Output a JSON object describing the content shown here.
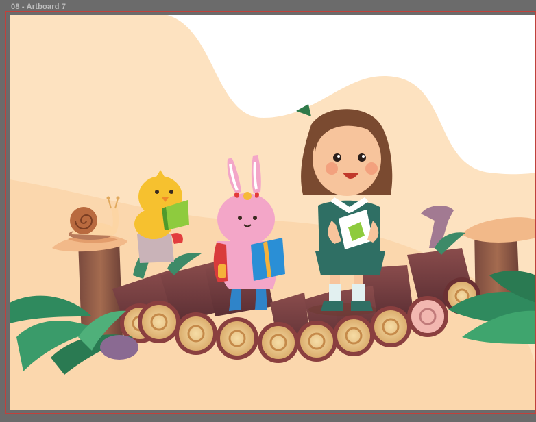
{
  "artboard": {
    "label": "08 - Artboard 7"
  },
  "illustration": {
    "characters": [
      "girl-character",
      "bunny-character",
      "chick-character",
      "snail-character"
    ],
    "colors": {
      "pasteboard": "#6b6b6b",
      "artboard_frame": "#c0413c",
      "sky": "#ffffff",
      "sand_light": "#fde2c0",
      "sand": "#fbd7ad",
      "log_dark": "#6e3a3a",
      "log_end": "#e9c98c",
      "leaf_green": "#2f8a5e",
      "girl_dress": "#2f6f64",
      "bunny_pink": "#f3a6c8",
      "chick_yellow": "#f6c12f",
      "book_blue": "#2a8fd6",
      "book_green": "#8ecb3e"
    }
  }
}
